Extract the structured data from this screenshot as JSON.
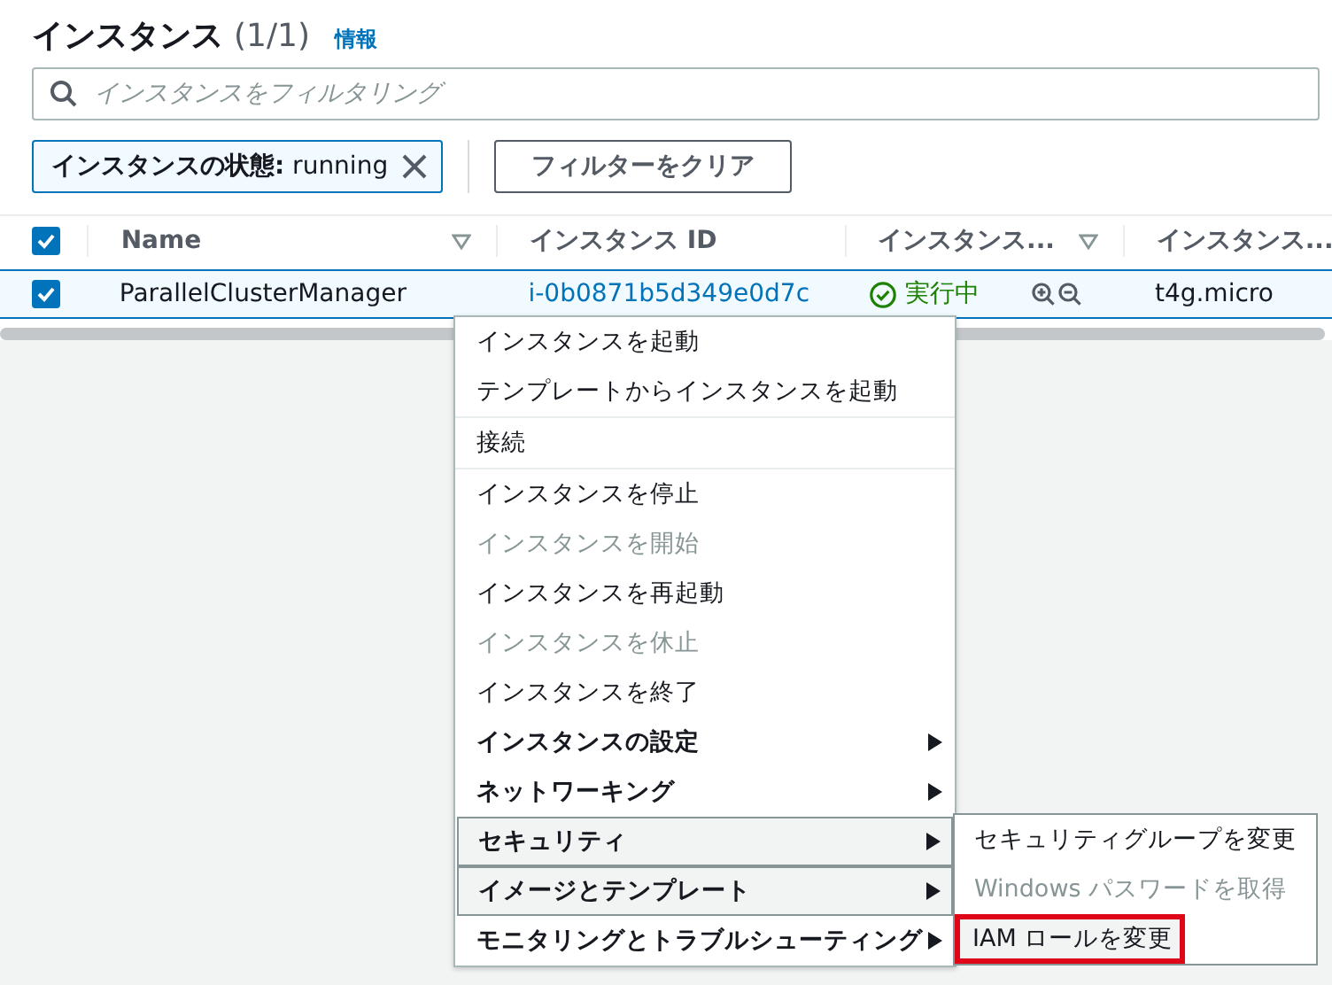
{
  "header": {
    "title": "インスタンス",
    "count": "(1/1)",
    "info_link": "情報"
  },
  "search": {
    "placeholder": "インスタンスをフィルタリング"
  },
  "filter_token": {
    "label": "インスタンスの状態:",
    "value": "running"
  },
  "clear_button": "フィルターをクリア",
  "table": {
    "all_checked": true,
    "columns": [
      {
        "label": "Name",
        "filter": true
      },
      {
        "label": "インスタンス ID",
        "filter": false
      },
      {
        "label": "インスタンス...",
        "filter": true
      },
      {
        "label": "インスタンス..."
      }
    ],
    "rows": [
      {
        "checked": true,
        "name": "ParallelClusterManager",
        "instance_id": "i-0b0871b5d349e0d7c",
        "state": "実行中",
        "type": "t4g.micro"
      }
    ]
  },
  "menu": [
    {
      "label": "インスタンスを起動",
      "kind": "action",
      "disabled": false,
      "highlighted": false,
      "divider_after": false
    },
    {
      "label": "テンプレートからインスタンスを起動",
      "kind": "action",
      "disabled": false,
      "highlighted": false,
      "divider_after": true
    },
    {
      "label": "接続",
      "kind": "action",
      "disabled": false,
      "highlighted": false,
      "divider_after": true
    },
    {
      "label": "インスタンスを停止",
      "kind": "action",
      "disabled": false,
      "highlighted": false,
      "divider_after": false
    },
    {
      "label": "インスタンスを開始",
      "kind": "action",
      "disabled": true,
      "highlighted": false,
      "divider_after": false
    },
    {
      "label": "インスタンスを再起動",
      "kind": "action",
      "disabled": false,
      "highlighted": false,
      "divider_after": false
    },
    {
      "label": "インスタンスを休止",
      "kind": "action",
      "disabled": true,
      "highlighted": false,
      "divider_after": false
    },
    {
      "label": "インスタンスを終了",
      "kind": "action",
      "disabled": false,
      "highlighted": false,
      "divider_after": false
    },
    {
      "label": "インスタンスの設定",
      "kind": "submenu",
      "disabled": false,
      "highlighted": false,
      "divider_after": false
    },
    {
      "label": "ネットワーキング",
      "kind": "submenu",
      "disabled": false,
      "highlighted": false,
      "divider_after": false
    },
    {
      "label": "セキュリティ",
      "kind": "submenu",
      "disabled": false,
      "highlighted": true,
      "divider_after": false
    },
    {
      "label": "イメージとテンプレート",
      "kind": "submenu",
      "disabled": false,
      "highlighted": true,
      "divider_after": false
    },
    {
      "label": "モニタリングとトラブルシューティング",
      "kind": "submenu",
      "disabled": false,
      "highlighted": false,
      "divider_after": false
    }
  ],
  "submenu": [
    {
      "label": "セキュリティグループを変更",
      "disabled": false,
      "highlighted": false,
      "annotated": false
    },
    {
      "label": "Windows パスワードを取得",
      "disabled": true,
      "highlighted": false,
      "annotated": false
    },
    {
      "label": "IAM ロールを変更",
      "disabled": false,
      "highlighted": true,
      "annotated": true
    }
  ]
}
